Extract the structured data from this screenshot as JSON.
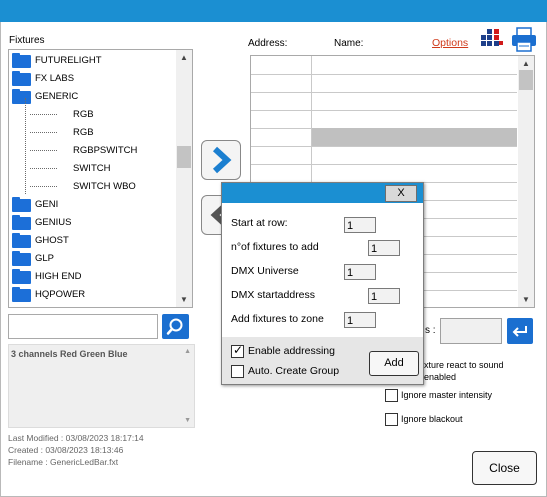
{
  "fixtures_label": "Fixtures",
  "address_label": "Address:",
  "name_label": "Name:",
  "options_link": "Options",
  "tree": [
    {
      "label": "FUTURELIGHT",
      "type": "folder"
    },
    {
      "label": "FX LABS",
      "type": "folder"
    },
    {
      "label": "GENERIC",
      "type": "folder"
    },
    {
      "label": "RGB",
      "type": "child"
    },
    {
      "label": "RGB",
      "type": "child"
    },
    {
      "label": "RGBPSWITCH",
      "type": "child"
    },
    {
      "label": "SWITCH",
      "type": "child"
    },
    {
      "label": "SWITCH WBO",
      "type": "child"
    },
    {
      "label": "GENI",
      "type": "folder"
    },
    {
      "label": "GENIUS",
      "type": "folder"
    },
    {
      "label": "GHOST",
      "type": "folder"
    },
    {
      "label": "GLP",
      "type": "folder"
    },
    {
      "label": "HIGH END",
      "type": "folder"
    },
    {
      "label": "HQPOWER",
      "type": "folder"
    }
  ],
  "search": {
    "value": ""
  },
  "description": "3 channels Red Green Blue",
  "meta": {
    "last_modified": "Last Modified : 03/08/2023 18:17:14",
    "created": "Created : 03/08/2023 18:13:46",
    "filename": "Filename : GenericLedBar.fxt"
  },
  "dialog": {
    "close_label": "X",
    "start_row_label": "Start at row:",
    "start_row_value": "1",
    "count_label": "n°of fixtures to add",
    "count_value": "1",
    "universe_label": "DMX Universe",
    "universe_value": "1",
    "startaddress_label": "DMX startaddress",
    "startaddress_value": "1",
    "zone_label": "Add fixtures to zone",
    "zone_value": "1",
    "enable_addressing_label": "Enable addressing",
    "enable_addressing_checked": true,
    "auto_group_label": "Auto. Create Group",
    "auto_group_checked": false,
    "add_button": "Add"
  },
  "right_panel": {
    "partial_label": "s :",
    "react_line1": "xture react to sound",
    "react_line2": "enabled",
    "ignore_master_label": "Ignore master intensity",
    "ignore_blackout_label": "Ignore blackout"
  },
  "close_button": "Close",
  "colors": {
    "accent": "#1b8fd2",
    "folder": "#1c6fd8",
    "selected_row": "#c0c0c0",
    "options_link": "#d03a1a"
  }
}
